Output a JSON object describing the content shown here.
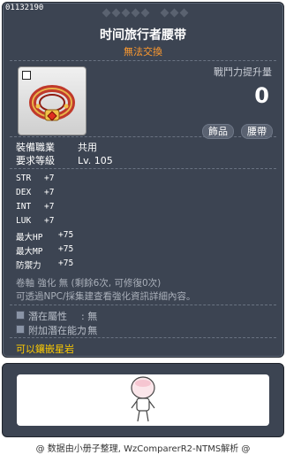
{
  "item": {
    "id": "01132190",
    "name": "时间旅行者腰带",
    "trade": "無法交換",
    "power_label": "戰鬥力提升量",
    "power_value": "0",
    "tags": [
      "飾品",
      "腰帶"
    ],
    "job_label": "裝備職業",
    "job_value": "共用",
    "level_label": "要求等級",
    "level_value": "Lv. 105"
  },
  "stats": [
    {
      "name": "STR",
      "value": "+7"
    },
    {
      "name": "DEX",
      "value": "+7"
    },
    {
      "name": "INT",
      "value": "+7"
    },
    {
      "name": "LUK",
      "value": "+7"
    },
    {
      "name": "最大HP",
      "value": "+75"
    },
    {
      "name": "最大MP",
      "value": "+75"
    },
    {
      "name": "防禦力",
      "value": "+75"
    }
  ],
  "notes": {
    "scroll": "卷軸 強化 無 (剩餘6次, 可修復0次)",
    "hint": "可透過NPC/採集建查看強化資訊詳細內容。"
  },
  "potentials": [
    {
      "label": "潛在屬性",
      "value": ": 無"
    },
    {
      "label": "附加潛在能力",
      "value": ": 無"
    }
  ],
  "socket": "可以鑲嵌星岩",
  "footer": "@ 数据由小册子整理, WzComparerR2-NTMS解析 @",
  "colors": {
    "panel_bg": "#3c4452",
    "trade_text": "#ff9a2e",
    "socket_text": "#ffcc00"
  }
}
